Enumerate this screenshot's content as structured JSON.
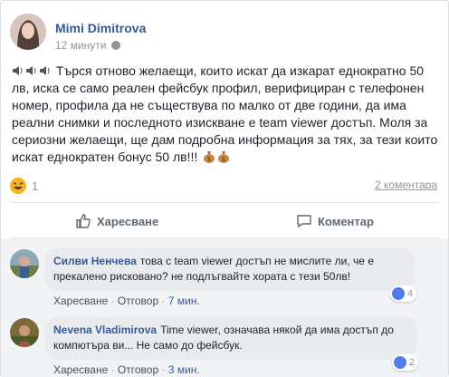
{
  "post": {
    "author": "Mimi Dimitrova",
    "time": "12 минути",
    "body": "Търся отново желаещи, които искат да изкарат еднократно 50 лв, иска се само реален фейсбук профил, верифициран с телефонен номер, профила да не съществува по малко от две години, да има реални снимки и последното изискване е team viewer достъп. Моля за сериозни желаещи, ще дам подробна информация за тях, за тези които искат еднократен бонус 50 лв!!!",
    "reaction_count": "1",
    "comments_count": "2 коментара"
  },
  "actions": {
    "like": "Харесване",
    "comment": "Коментар"
  },
  "comments": [
    {
      "author": "Силви Ненчева",
      "text": "това с team viewer достъп не мислите ли, че е прекалено рисковано? не подлъгвайте хората с тези 50лв!",
      "like": "Харесване",
      "reply": "Отговор",
      "time": "7 мин.",
      "likes": "4"
    },
    {
      "author": "Nevena Vladimirova",
      "text": "Time viewer, означава някой да има достъп до компютъра ви... Не само до фейсбук.",
      "like": "Харесване",
      "reply": "Отговор",
      "time": "3 мин.",
      "likes": "2"
    }
  ],
  "colors": {
    "link": "#365899",
    "muted": "#90949c",
    "action": "#606770",
    "comment_bg": "#f2f3f5",
    "bubble_bg": "#e9ebee",
    "like_blue": "#4f7ded",
    "haha": "#f7b125"
  },
  "icons": [
    "speaker-icon",
    "money-bag-icon",
    "haha-icon",
    "thumbs-up-icon",
    "comment-icon",
    "globe-icon"
  ]
}
